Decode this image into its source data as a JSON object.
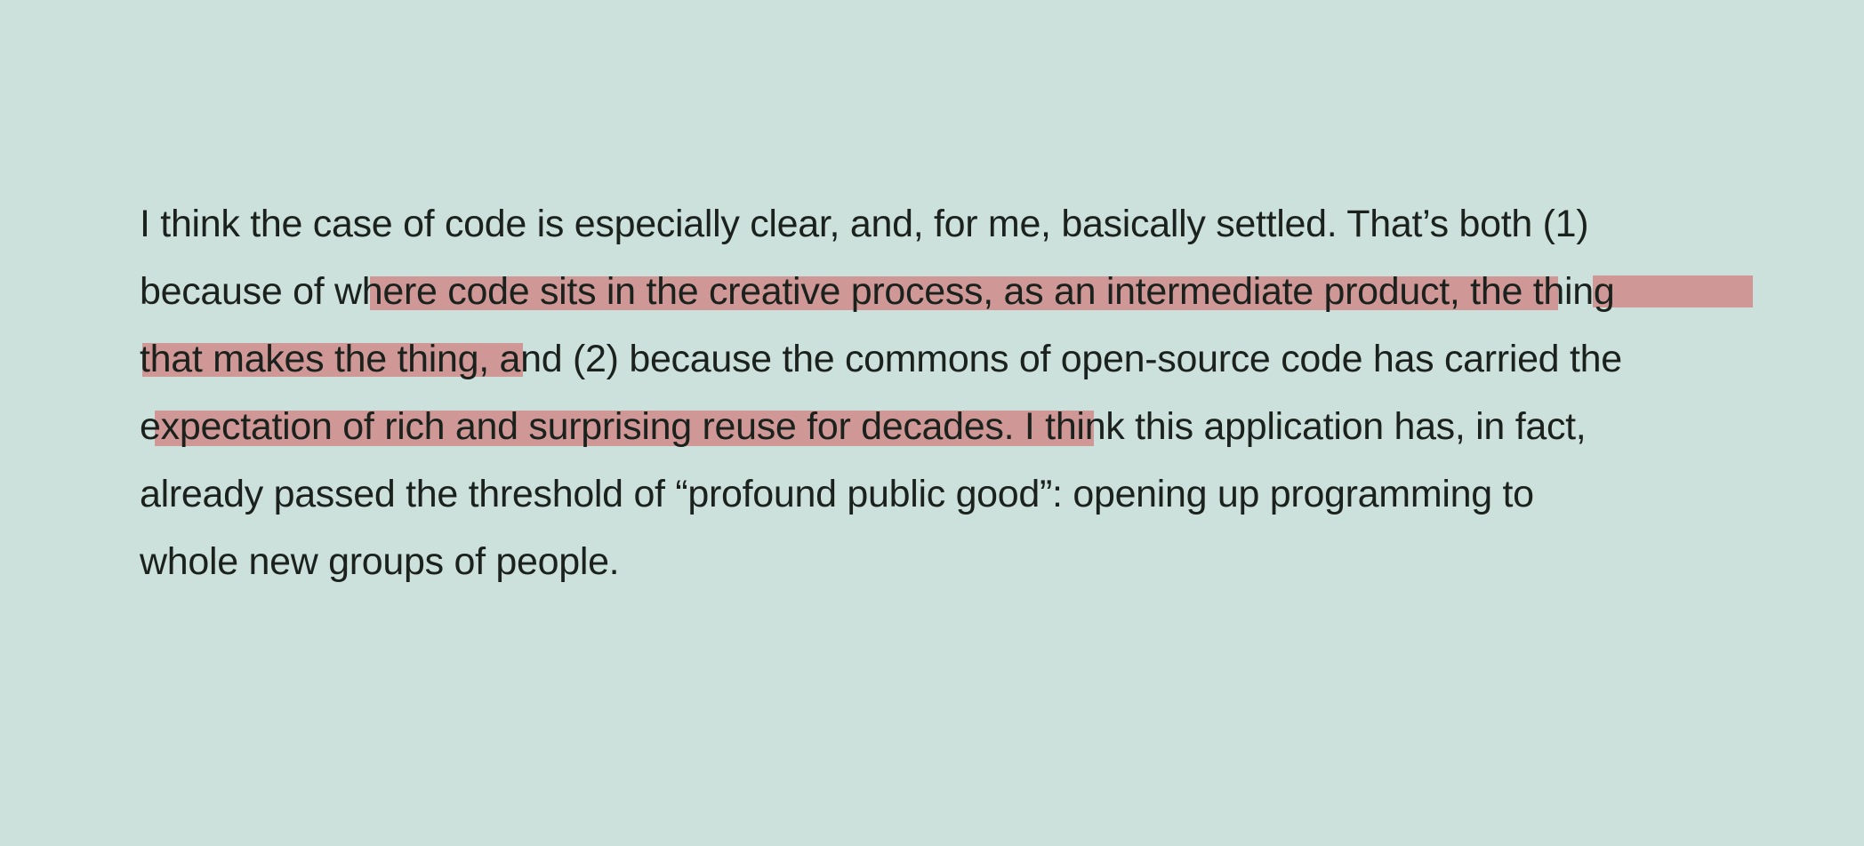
{
  "passage": {
    "line1": "I think the case of code is especially clear, and, for me, basically settled. That’s both (1)",
    "line2_pre": "because of w",
    "line2_hl1": "here code sits in the creative process, as an intermediate product",
    "line2_mid": ", t",
    "line2_hl2": "he thing",
    "line3_hl": "that makes the thing,",
    "line3_post": " and (2) because the commons of open-source code has carried the",
    "line4_pre": "e",
    "line4_hl": "xpectation of rich and surprising reuse for decades.",
    "line4_post": " I think this application has, in fact,",
    "line5": "already passed the threshold of “profound public good”: opening up programming to",
    "line6": "whole new groups of people."
  },
  "colors": {
    "background": "#cde1dc",
    "text": "#1b211d",
    "highlight": "#cf9896"
  }
}
